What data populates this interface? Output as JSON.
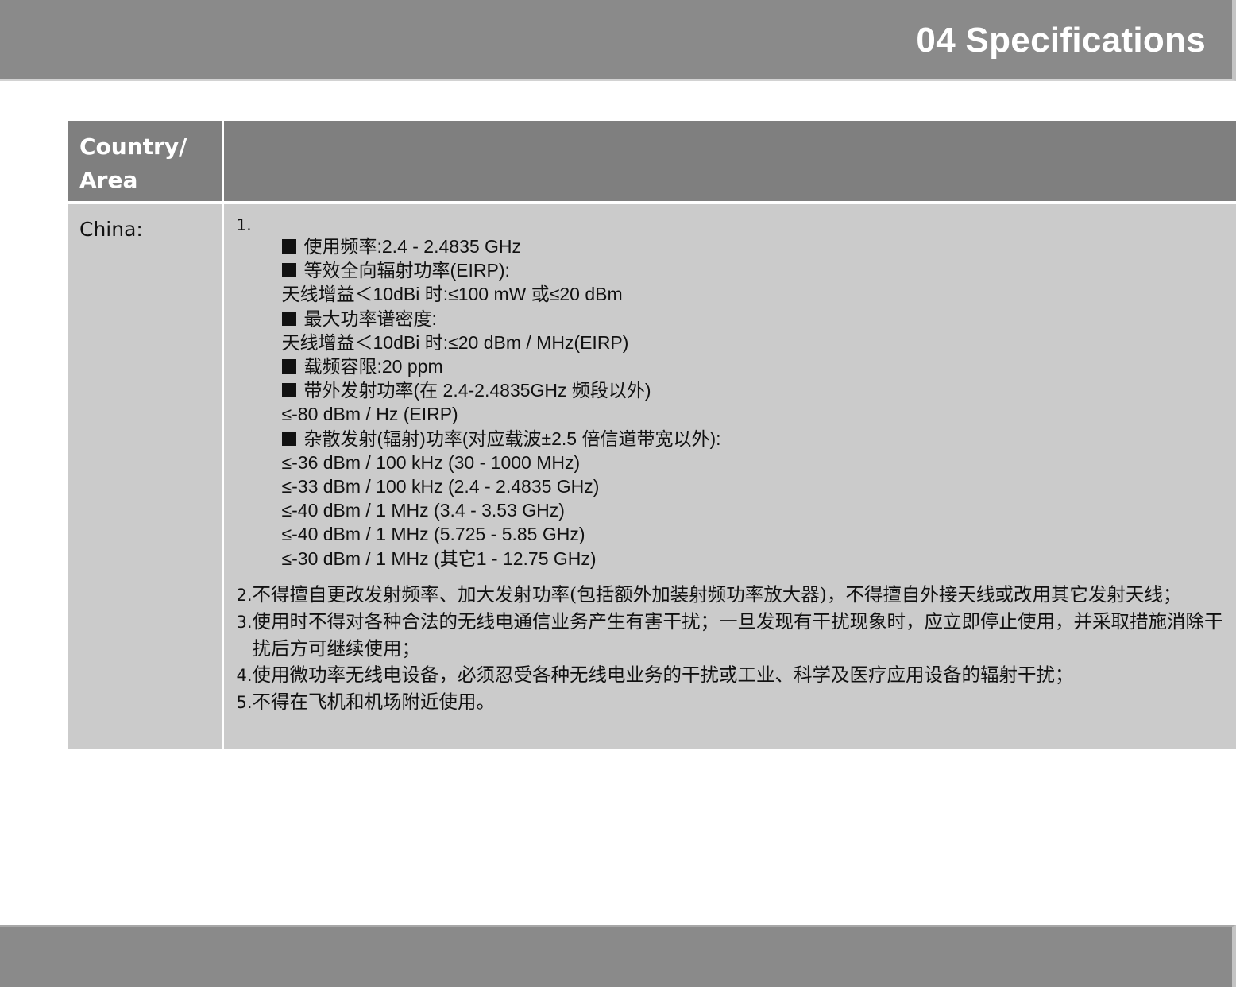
{
  "header": {
    "title": "04 Specifications"
  },
  "table": {
    "columns": [
      "Country/\nArea",
      ""
    ],
    "column_1_lines": [
      "Country/",
      "Area"
    ],
    "rows": [
      {
        "country": "China:",
        "item1_number": "1.",
        "spec_lines": [
          {
            "bullet": true,
            "text": "使用频率:2.4 - 2.4835 GHz"
          },
          {
            "bullet": true,
            "text": "等效全向辐射功率(EIRP):"
          },
          {
            "bullet": false,
            "text": "天线增益＜10dBi 时:≤100 mW 或≤20 dBm"
          },
          {
            "bullet": true,
            "text": "最大功率谱密度:"
          },
          {
            "bullet": false,
            "text": "天线增益＜10dBi 时:≤20 dBm / MHz(EIRP)"
          },
          {
            "bullet": true,
            "text": "载频容限:20 ppm"
          },
          {
            "bullet": true,
            "text": "带外发射功率(在 2.4-2.4835GHz 频段以外)"
          },
          {
            "bullet": false,
            "text": "≤-80 dBm / Hz (EIRP)"
          },
          {
            "bullet": true,
            "text": "杂散发射(辐射)功率(对应载波±2.5 倍信道带宽以外):"
          },
          {
            "bullet": false,
            "text": "≤-36 dBm / 100 kHz (30 - 1000 MHz)"
          },
          {
            "bullet": false,
            "text": "≤-33 dBm / 100 kHz (2.4 - 2.4835 GHz)"
          },
          {
            "bullet": false,
            "text": "≤-40 dBm / 1 MHz (3.4 - 3.53 GHz)"
          },
          {
            "bullet": false,
            "text": "≤-40 dBm / 1 MHz (5.725 - 5.85 GHz)"
          },
          {
            "bullet": false,
            "text": "≤-30 dBm / 1 MHz (其它1 - 12.75 GHz)"
          }
        ],
        "notes": [
          {
            "num": "2.",
            "text": "不得擅自更改发射频率、加大发射功率(包括额外加装射频功率放大器)，不得擅自外接天线或改用其它发射天线；"
          },
          {
            "num": "3.",
            "text": "使用时不得对各种合法的无线电通信业务产生有害干扰；一旦发现有干扰现象时，应立即停止使用，并采取措施消除干扰后方可继续使用；"
          },
          {
            "num": "4.",
            "text": "使用微功率无线电设备，必须忍受各种无线电业务的干扰或工业、科学及医疗应用设备的辐射干扰；"
          },
          {
            "num": "5.",
            "text": "不得在飞机和机场附近使用。"
          }
        ]
      }
    ]
  },
  "colors": {
    "header_bar": "#8a8a8a",
    "table_header": "#7f7f7f",
    "table_body": "#cbcbcb",
    "title_text": "#ffffff"
  }
}
